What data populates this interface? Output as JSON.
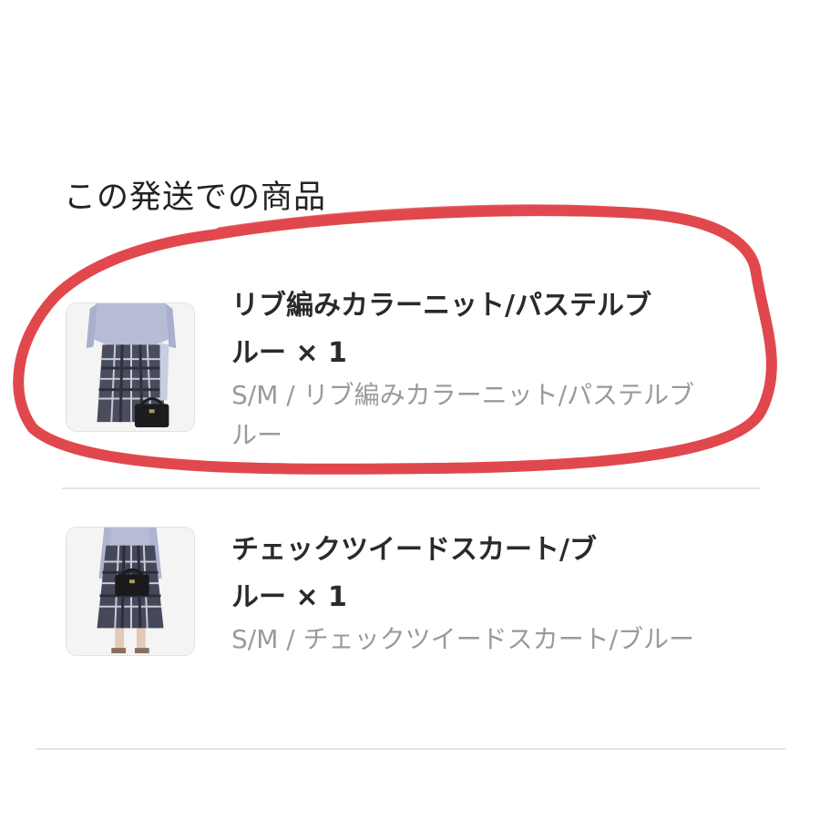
{
  "section": {
    "title": "この発送での商品"
  },
  "items": [
    {
      "name_line1": "リブ編みカラーニット/パステルブ",
      "name_line2": "ルー × 1",
      "variant_line1": "S/M / リブ編みカラーニット/パステルブ",
      "variant_line2": "ルー"
    },
    {
      "name_line1": "チェックツイードスカート/ブ",
      "name_line2": "ルー × 1",
      "variant_line1": "S/M / チェックツイードスカート/ブルー"
    }
  ],
  "colors": {
    "annotation": "#e0484e",
    "text_primary": "#2a2a2a",
    "text_secondary": "#9a9a9a",
    "divider": "#e4e4e4"
  }
}
